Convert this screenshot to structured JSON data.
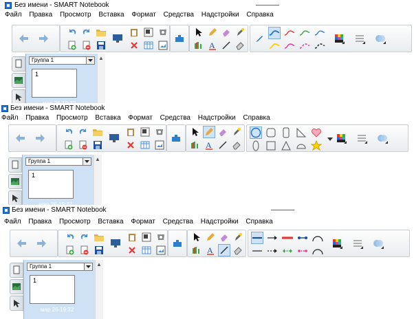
{
  "window": {
    "title": "Без имени - SMART Notebook"
  },
  "menu": [
    "Файл",
    "Правка",
    "Просмотр",
    "Вставка",
    "Формат",
    "Средства",
    "Надстройки",
    "Справка"
  ],
  "sorter": {
    "group_label": "Группа 1",
    "page_number": "1",
    "date": "мар 26-19:32"
  },
  "colors": {
    "accent": "#1f73d6",
    "red": "#e53935",
    "green": "#3aa845",
    "pink": "#e03a9a",
    "yellow": "#ffd400",
    "blue": "#1b6fd1",
    "teal": "#22b3a9"
  },
  "toolbar_icons": [
    "back-arrow-icon",
    "forward-arrow-icon",
    "undo-icon",
    "redo-icon",
    "open-folder-icon",
    "add-page-icon",
    "delete-page-icon",
    "save-icon",
    "display-icon",
    "paste-icon",
    "screen-shade-icon",
    "delete-icon",
    "capture-icon",
    "table-icon",
    "insert-image-icon",
    "close-x-icon",
    "addon-icon",
    "select-icon",
    "pen-icon",
    "eraser-icon",
    "magic-pen-icon",
    "creative-pen-icon",
    "text-icon",
    "line-icon",
    "fill-icon"
  ],
  "snapshots": [
    {
      "mode": "pens",
      "properties": [
        "pen-style-icon",
        "line-style-icon",
        "transparency-icon"
      ]
    },
    {
      "mode": "shapes",
      "properties": [
        "shape-circle",
        "shape-square",
        "shape-rect",
        "shape-triangle-right",
        "shape-heart",
        "shape-ellipse",
        "shape-square-2",
        "shape-triangle",
        "shape-semicircle",
        "shape-star"
      ]
    },
    {
      "mode": "lines",
      "properties": [
        "line-plain",
        "line-arrow-end",
        "line-red-thick",
        "line-dot-end",
        "line-arc",
        "line-dash",
        "line-dash-arrow",
        "line-green-dash",
        "line-pink-dash",
        "line-arc-2"
      ]
    }
  ]
}
